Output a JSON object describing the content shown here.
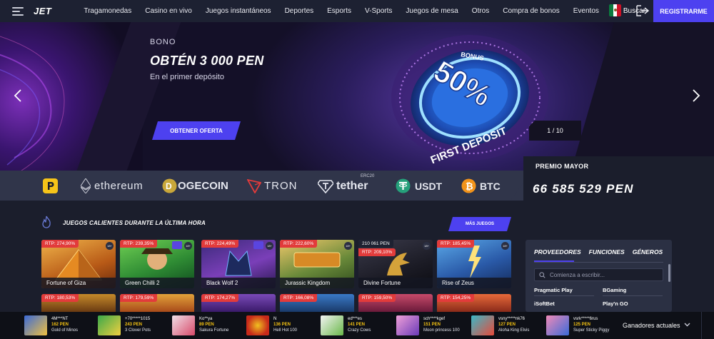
{
  "header": {
    "logo": "JET",
    "nav": [
      "Tragamonedas",
      "Casino en vivo",
      "Juegos instantáneos",
      "Deportes",
      "Esports",
      "V-Sports",
      "Juegos de mesa",
      "Otros",
      "Compra de bonos",
      "Eventos"
    ],
    "search": "Buscar",
    "register": "REGISTRARME"
  },
  "hero": {
    "eyebrow": "BONO",
    "title": "OBTÉN 3 000 PEN",
    "subtitle": "En el primer depósito",
    "cta": "OBTENER OFERTA",
    "pager": "1 / 10",
    "badge_small": "BONUS",
    "badge_big": "50%",
    "badge_ring": "FIRST DEPOSIT"
  },
  "crypto": {
    "ethereum": "ethereum",
    "dogecoin": "OGECOIN",
    "tron": "TRON",
    "tether": "tether",
    "tether_sup": "ERC20",
    "usdt": "USDT",
    "btc": "BTC"
  },
  "jackpot": {
    "label": "PREMIO MAYOR",
    "value": "66 585 529 PEN"
  },
  "section": {
    "title": "JUEGOS CALIENTES DURANTE LA ÚLTIMA HORA",
    "more": "MÁS JUEGOS"
  },
  "games": [
    {
      "rtp": "RTP: 274,90%",
      "name": "Fortune of Giza",
      "badge": "18+"
    },
    {
      "rtp": "RTP: 239,35%",
      "name": "Green Chilli 2",
      "badge": "18+"
    },
    {
      "rtp": "RTP: 224,49%",
      "name": "Black Wolf 2",
      "badge": "18+"
    },
    {
      "rtp": "RTP: 222,60%",
      "name": "Jurassic Kingdom",
      "badge": "18+"
    },
    {
      "rtp": "RTP: 209,10%",
      "top": "210 061 PEN",
      "name": "Divine Fortune",
      "badge": "18+"
    },
    {
      "rtp": "RTP: 185,45%",
      "name": "Rise of Zeus",
      "badge": "18+"
    }
  ],
  "games_row2": [
    "RTP: 180,53%",
    "RTP: 179,59%",
    "RTP: 174,27%",
    "RTP: 166,08%",
    "RTP: 159,50%",
    "RTP: 154,25%"
  ],
  "providers": {
    "tabs": [
      "PROVEEDORES",
      "FUNCIONES",
      "GÉNEROS"
    ],
    "placeholder": "Comienza a escribir...",
    "items": [
      "Pragmatic Play",
      "BGaming",
      "iSoftBet",
      "Play'n GO"
    ]
  },
  "winners": {
    "label": "Ganadores actuales",
    "items": [
      {
        "user": "4M***NT",
        "amount": "162 PEN",
        "game": "Gold of Minos"
      },
      {
        "user": "+70*****1015",
        "amount": "243 PEN",
        "game": "3 Clover Pots"
      },
      {
        "user": "Ko**ya",
        "amount": "89 PEN",
        "game": "Sakura Fortune"
      },
      {
        "user": "N",
        "amount": "136 PEN",
        "game": "Hell Hot 100"
      },
      {
        "user": "ed***es",
        "amount": "141 PEN",
        "game": "Crazy Cows"
      },
      {
        "user": "sch****kgef",
        "amount": "151 PEN",
        "game": "Moon princess 100"
      },
      {
        "user": "vsny*****nk76",
        "amount": "127 PEN",
        "game": "Aloha King Elvis"
      },
      {
        "user": "vsrk*****6rus",
        "amount": "125 PEN",
        "game": "Super Sticky Piggy"
      }
    ]
  },
  "colors": {
    "accent": "#4d41f0",
    "rtp": "#e23b3b",
    "gold": "#f2c012"
  }
}
